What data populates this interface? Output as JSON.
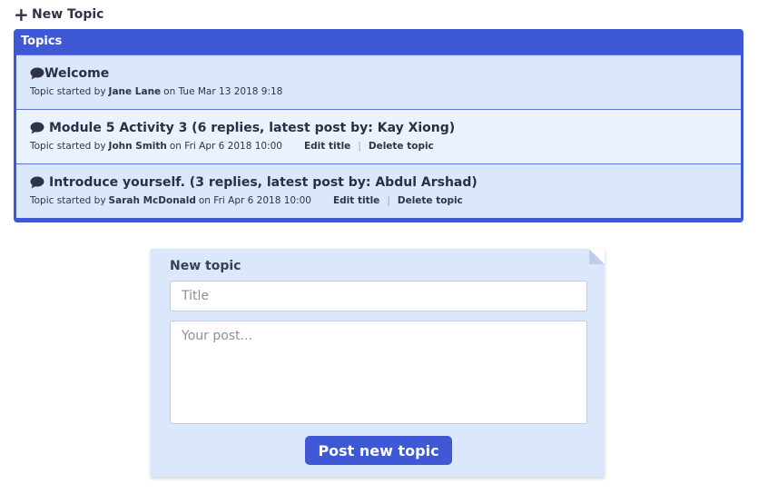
{
  "header": {
    "new_topic_label": "New Topic",
    "new_topic_icon": "plus-icon"
  },
  "topics_panel": {
    "title": "Topics",
    "topics": [
      {
        "title": "Welcome",
        "started_prefix": "Topic started by",
        "author": "Jane Lane",
        "date_text": "on Tue Mar 13 2018 9:18",
        "actions": []
      },
      {
        "title": "Module 5 Activity 3 (6 replies, latest post by: Kay Xiong)",
        "started_prefix": "Topic started by",
        "author": "John Smith",
        "date_text": "on Fri Apr 6 2018 10:00",
        "actions": [
          "Edit title",
          "Delete topic"
        ]
      },
      {
        "title": "Introduce yourself. (3 replies, latest post by: Abdul Arshad)",
        "started_prefix": "Topic started by",
        "author": "Sarah McDonald",
        "date_text": "on Fri Apr 6 2018 10:00",
        "actions": [
          "Edit title",
          "Delete topic"
        ]
      }
    ]
  },
  "new_topic_form": {
    "label": "New topic",
    "title_placeholder": "Title",
    "post_placeholder": "Your post...",
    "submit_label": "Post new topic"
  },
  "colors": {
    "accent": "#3f59d6",
    "row_light": "#dbe7fb",
    "row_lighter": "#ebf2fd",
    "text_dark": "#2a2f45"
  }
}
